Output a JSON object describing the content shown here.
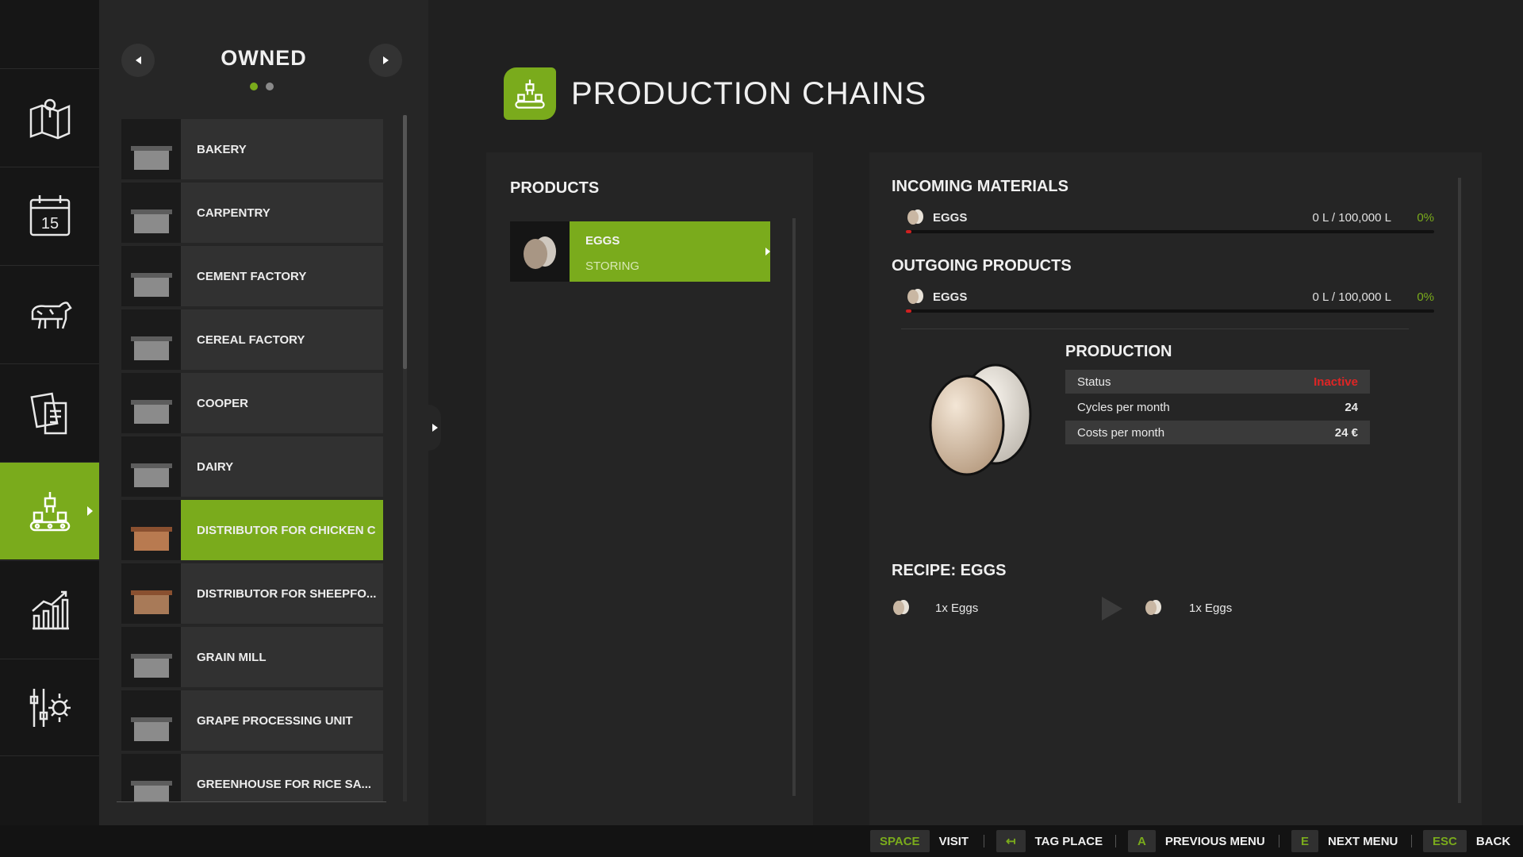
{
  "list_header": {
    "title": "OWNED",
    "page_count": 2,
    "active_page": 1
  },
  "list_items": [
    {
      "label": "BAKERY"
    },
    {
      "label": "CARPENTRY"
    },
    {
      "label": "CEMENT FACTORY"
    },
    {
      "label": "CEREAL FACTORY"
    },
    {
      "label": "COOPER"
    },
    {
      "label": "DAIRY"
    },
    {
      "label": "DISTRIBUTOR FOR CHICKEN C"
    },
    {
      "label": "DISTRIBUTOR FOR SHEEPFO..."
    },
    {
      "label": "GRAIN MILL"
    },
    {
      "label": "GRAPE PROCESSING UNIT"
    },
    {
      "label": "GREENHOUSE FOR RICE SA..."
    }
  ],
  "selected_list_index": 6,
  "header": {
    "title": "PRODUCTION CHAINS"
  },
  "products": {
    "title": "PRODUCTS",
    "items": [
      {
        "name": "EGGS",
        "status": "STORING"
      }
    ]
  },
  "incoming": {
    "title": "INCOMING MATERIALS",
    "items": [
      {
        "name": "EGGS",
        "amount": "0 L / 100,000 L",
        "percent": "0%",
        "fill": 0
      }
    ]
  },
  "outgoing": {
    "title": "OUTGOING PRODUCTS",
    "items": [
      {
        "name": "EGGS",
        "amount": "0 L / 100,000 L",
        "percent": "0%",
        "fill": 0
      }
    ]
  },
  "production": {
    "title": "PRODUCTION",
    "stats": [
      {
        "label": "Status",
        "value": "Inactive"
      },
      {
        "label": "Cycles per month",
        "value": "24"
      },
      {
        "label": "Costs per month",
        "value": "24 €"
      }
    ]
  },
  "recipe": {
    "title": "RECIPE: EGGS",
    "input": "1x Eggs",
    "output": "1x Eggs"
  },
  "bottom_hints": [
    {
      "key": "SPACE",
      "label": "VISIT"
    },
    {
      "key": "↤",
      "label": "TAG PLACE"
    },
    {
      "key": "A",
      "label": "PREVIOUS MENU"
    },
    {
      "key": "E",
      "label": "NEXT MENU"
    },
    {
      "key": "ESC",
      "label": "BACK"
    }
  ],
  "nav_items": [
    {
      "icon": "map-icon"
    },
    {
      "icon": "calendar-icon",
      "text": "15"
    },
    {
      "icon": "animals-icon"
    },
    {
      "icon": "contracts-icon"
    },
    {
      "icon": "production-icon"
    },
    {
      "icon": "statistics-icon"
    },
    {
      "icon": "settings-icon"
    }
  ],
  "active_nav_index": 4,
  "colors": {
    "accent": "#7aab1c",
    "status_inactive": "#e02525",
    "bar_fill": "#d02020"
  }
}
